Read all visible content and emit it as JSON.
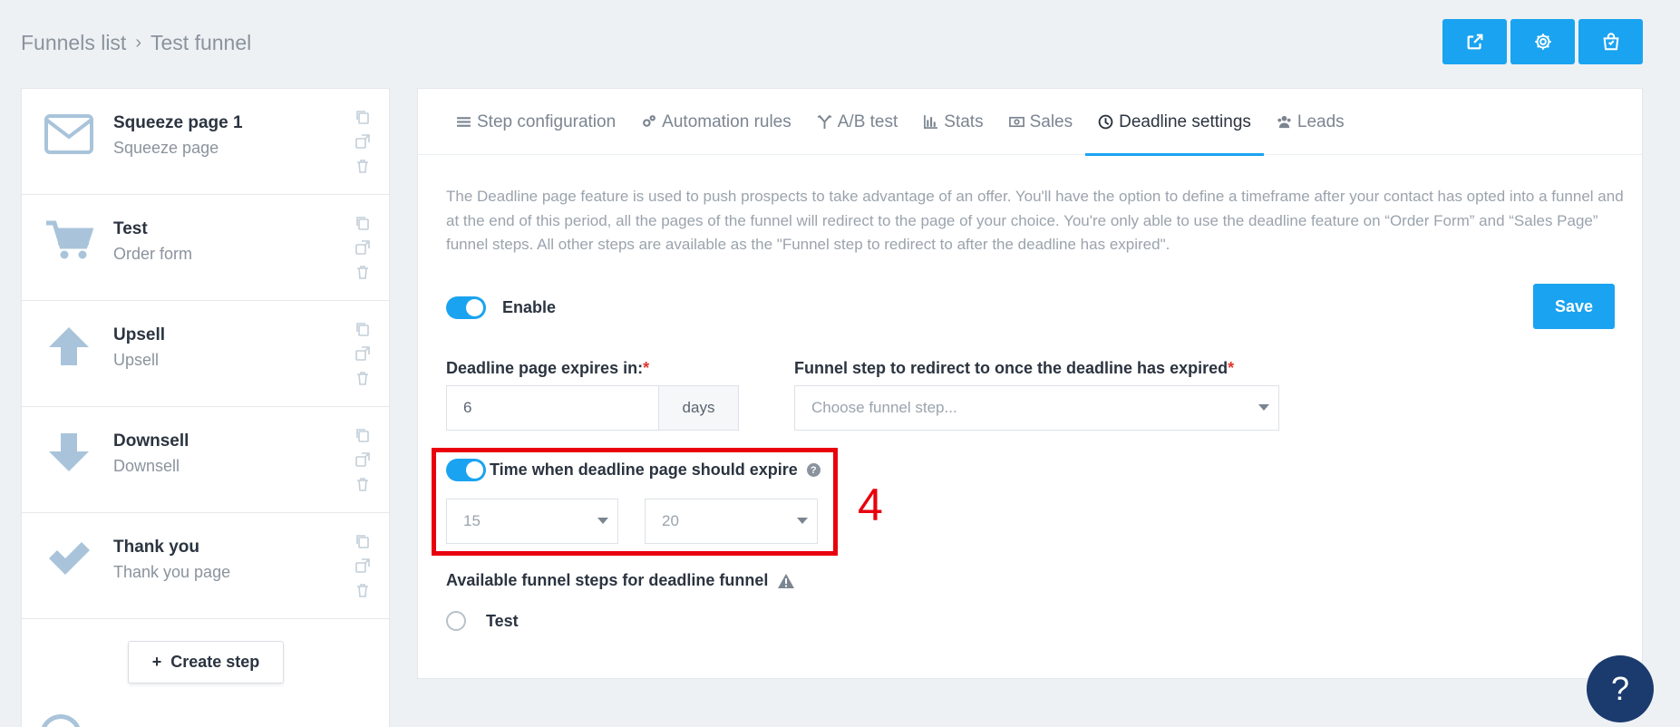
{
  "breadcrumb": {
    "root": "Funnels list",
    "separator": "›",
    "current": "Test funnel"
  },
  "top_actions": [
    {
      "name": "external-link-icon"
    },
    {
      "name": "gear-icon"
    },
    {
      "name": "shop-bag-icon"
    }
  ],
  "steps": [
    {
      "title": "Squeeze page 1",
      "subtitle": "Squeeze page",
      "icon": "envelope-icon"
    },
    {
      "title": "Test",
      "subtitle": "Order form",
      "icon": "cart-icon"
    },
    {
      "title": "Upsell",
      "subtitle": "Upsell",
      "icon": "arrow-up-icon"
    },
    {
      "title": "Downsell",
      "subtitle": "Downsell",
      "icon": "arrow-down-icon"
    },
    {
      "title": "Thank you",
      "subtitle": "Thank you page",
      "icon": "check-icon"
    }
  ],
  "create_step": {
    "plus": "+",
    "label": "Create step"
  },
  "tabs": [
    {
      "label": "Step configuration",
      "icon": "list-icon"
    },
    {
      "label": "Automation rules",
      "icon": "cogs-icon"
    },
    {
      "label": "A/B test",
      "icon": "split-icon"
    },
    {
      "label": "Stats",
      "icon": "bar-chart-icon"
    },
    {
      "label": "Sales",
      "icon": "money-icon"
    },
    {
      "label": "Deadline settings",
      "icon": "clock-icon",
      "active": true
    },
    {
      "label": "Leads",
      "icon": "users-icon"
    }
  ],
  "deadline": {
    "description": "The Deadline page feature is used to push prospects to take advantage of an offer. You'll have the option to define a timeframe after your contact has opted into a funnel and at the end of this period, all the pages of the funnel will redirect to the page of your choice. You're only able to use the deadline feature on “Order Form” and “Sales Page” funnel steps. All other steps are available as the \"Funnel step to redirect to after the deadline has expired\".",
    "enable_label": "Enable",
    "save_label": "Save",
    "expires_label": "Deadline page expires in:",
    "required_mark": "*",
    "expires_value": "6",
    "expires_unit": "days",
    "redirect_label": "Funnel step to redirect to once the deadline has expired",
    "redirect_placeholder": "Choose funnel step...",
    "time_label": "Time when deadline page should expire",
    "help_mark": "?",
    "hour_value": "15",
    "minute_value": "20",
    "annotation_number": "4",
    "available_label": "Available funnel steps for deadline funnel",
    "available_steps": [
      {
        "label": "Test"
      }
    ]
  },
  "help_fab": "?",
  "colors": {
    "accent": "#1aa3f0",
    "highlight": "#e8000d",
    "fab": "#1b3b6f",
    "icon_muted": "#a9c4da"
  }
}
